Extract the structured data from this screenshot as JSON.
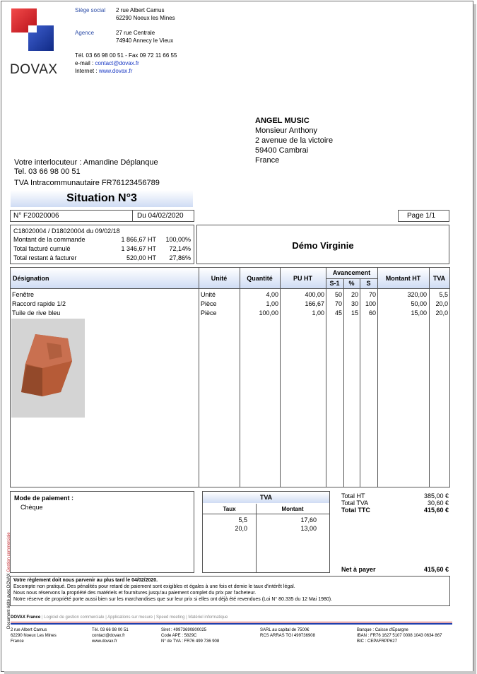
{
  "company": {
    "name": "DOVAX",
    "siege_label": "Siège social",
    "siege_line1": "2 rue Albert Camus",
    "siege_line2": "62290 Noeux les Mines",
    "agence_label": "Agence",
    "agence_line1": "27 rue Centrale",
    "agence_line2": "74940 Annecy le Vieux",
    "tel_fax": "Tél. 03 66 98 00 51 - Fax 09 72 11 66 55",
    "email_label": "e-mail :",
    "email": "contact@dovax.fr",
    "internet_label": "Internet :",
    "website": "www.dovax.fr"
  },
  "client": {
    "name": "ANGEL MUSIC",
    "contact": "Monsieur Anthony",
    "street": "2 avenue de la victoire",
    "city": "59400 Cambrai",
    "country": "France"
  },
  "interlocutor": {
    "name_line": "Votre interlocuteur : Amandine Déplanque",
    "tel_line": "Tel. 03 66 98 00 51",
    "tva_line": "TVA Intracommunautaire FR76123456789"
  },
  "document": {
    "title": "Situation N°3",
    "number": "N° F20020006",
    "date": "Du 04/02/2020",
    "page": "Page 1/1",
    "project_title": "Démo Virginie"
  },
  "summary": {
    "ref_line": "C18020004 / D18020004 du 09/02/18",
    "rows": [
      {
        "label": "Montant de la commande",
        "amount": "1 866,67 HT",
        "pct": "100,00%"
      },
      {
        "label": "Total facturé cumulé",
        "amount": "1 346,67 HT",
        "pct": "72,14%"
      },
      {
        "label": "Total restant à facturer",
        "amount": "520,00 HT",
        "pct": "27,86%"
      }
    ]
  },
  "table": {
    "headers": {
      "designation": "Désignation",
      "unite": "Unité",
      "quantite": "Quantité",
      "pu_ht": "PU HT",
      "avancement": "Avancement",
      "s1": "S-1",
      "pct": "%",
      "s": "S",
      "montant_ht": "Montant HT",
      "tva": "TVA"
    },
    "rows": [
      {
        "designation": "Fenêtre",
        "unite": "Unité",
        "quantite": "4,00",
        "pu_ht": "400,00",
        "s1": "50",
        "pct": "20",
        "s": "70",
        "montant": "320,00",
        "tva": "5,5"
      },
      {
        "designation": "Raccord rapide 1/2",
        "unite": "Pièce",
        "quantite": "1,00",
        "pu_ht": "166,67",
        "s1": "70",
        "pct": "30",
        "s": "100",
        "montant": "50,00",
        "tva": "20,0"
      },
      {
        "designation": "Tuile de rive bleu",
        "unite": "Pièce",
        "quantite": "100,00",
        "pu_ht": "1,00",
        "s1": "45",
        "pct": "15",
        "s": "60",
        "montant": "15,00",
        "tva": "20,0"
      }
    ]
  },
  "payment": {
    "label": "Mode de paiement :",
    "value": "Chèque"
  },
  "tva_box": {
    "title": "TVA",
    "col_taux": "Taux",
    "col_montant": "Montant",
    "rows": [
      {
        "taux": "5,5",
        "montant": "17,60"
      },
      {
        "taux": "20,0",
        "montant": "13,00"
      }
    ]
  },
  "totals": {
    "ht_label": "Total HT",
    "ht": "385,00 €",
    "tva_label": "Total TVA",
    "tva": "30,60 €",
    "ttc_label": "Total TTC",
    "ttc": "415,60 €",
    "net_label": "Net à payer",
    "net": "415,60 €"
  },
  "conditions": {
    "line1": "Votre règlement doit nous parvenir au plus tard le 04/02/2020.",
    "line2": "Escompte non pratiqué. Des pénalités pour retard de paiement sont exigibles et égales à une fois et demie le taux d'intérêt légal.",
    "line3": "Nous nous réservons la propriété des matériels et fournitures jusqu'au paiement complet du prix par l'acheteur.",
    "line4": "Notre réserve de propriété porte aussi bien sur les marchandises que sur leur prix si elles ont déjà été revendues (Loi N° 80.335 du 12 Mai 1980)."
  },
  "side_text": {
    "prefix": "Document édité avec DOVAX ",
    "link": "Gestion commerciale"
  },
  "footer": {
    "brand": "DOVAX France",
    "links": [
      "Logiciel de gestion commerciale",
      "Applications sur mesure",
      "Speed meeting",
      "Matériel informatique"
    ],
    "col1": [
      "2 rue Albert Camus",
      "62290 Noeux Les Mines",
      "France"
    ],
    "col2": [
      "Tél. 03 66 98 00 51",
      "contact@dovax.fr",
      "www.dovax.fr"
    ],
    "col3": [
      "Siret : 49973690800025",
      "Code APE : 5829C",
      "N° de TVA : FR76 499 736 908"
    ],
    "col4": [
      "SARL au capital de 7500€",
      "RCS ARRAS TGI 499736908"
    ],
    "col5": [
      "Banque : Caisse d'Epargne",
      "IBAN : FR76 1627 5107 0008 1043 0634 867",
      "BIC : CEPAFRPP627"
    ]
  },
  "colors": {
    "logo_red": "#e0202a",
    "logo_blue": "#1e3fae",
    "header_band": "#cfdcf4",
    "footer_rule_red": "#c0282d",
    "footer_rule_blue": "#1e3fae"
  }
}
